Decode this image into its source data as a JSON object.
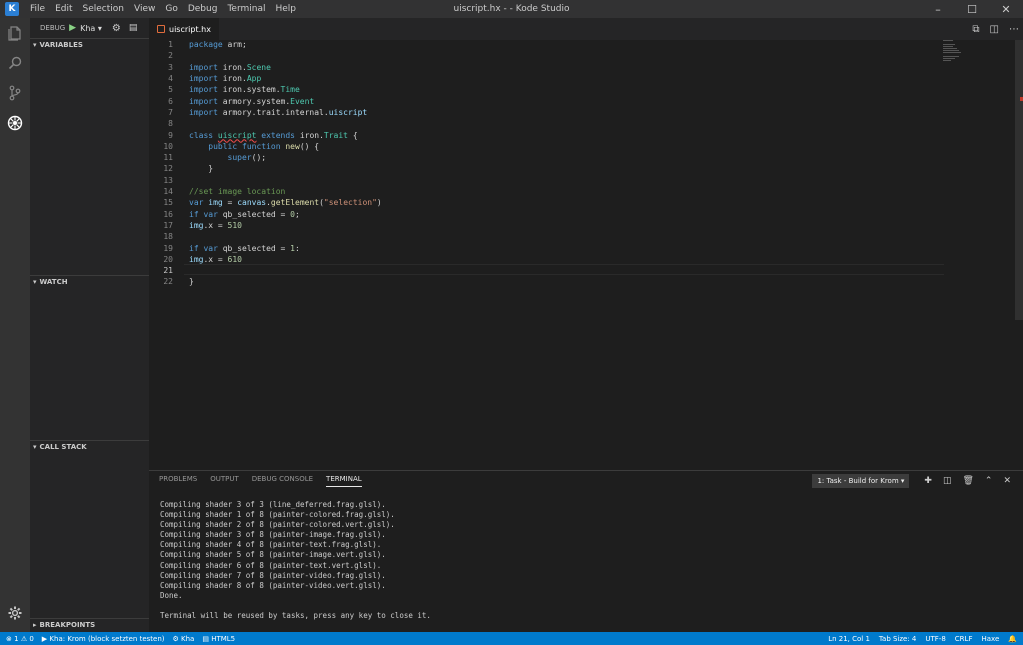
{
  "window": {
    "title": "uiscript.hx - - Kode Studio",
    "menu": [
      "File",
      "Edit",
      "Selection",
      "View",
      "Go",
      "Debug",
      "Terminal",
      "Help"
    ]
  },
  "debug_toolbar": {
    "label": "DEBUG",
    "config": "Kha"
  },
  "sidebar": {
    "variables": "VARIABLES",
    "watch": "WATCH",
    "call_stack": "CALL STACK",
    "breakpoints": "BREAKPOINTS"
  },
  "editor": {
    "tab_label": "uiscript.hx",
    "lines": [
      {
        "n": "1"
      },
      {
        "n": "2"
      },
      {
        "n": "3"
      },
      {
        "n": "4"
      },
      {
        "n": "5"
      },
      {
        "n": "6"
      },
      {
        "n": "7"
      },
      {
        "n": "8"
      },
      {
        "n": "9"
      },
      {
        "n": "10"
      },
      {
        "n": "11"
      },
      {
        "n": "12"
      },
      {
        "n": "13"
      },
      {
        "n": "14"
      },
      {
        "n": "15"
      },
      {
        "n": "16"
      },
      {
        "n": "17"
      },
      {
        "n": "18"
      },
      {
        "n": "19"
      },
      {
        "n": "20"
      },
      {
        "n": "21"
      },
      {
        "n": "22"
      }
    ],
    "code": {
      "l1a": "package",
      "l1b": " arm;",
      "l3a": "import",
      "l3b": " iron.",
      "l3c": "Scene",
      "l4a": "import",
      "l4b": " iron.",
      "l4c": "App",
      "l5a": "import",
      "l5b": " iron.system.",
      "l5c": "Time",
      "l6a": "import",
      "l6b": " armory.system.",
      "l6c": "Event",
      "l7a": "import",
      "l7b": " armory.trait.internal.",
      "l7c": "uiscript",
      "l9a": "class",
      "l9b": " ",
      "l9c": "uiscript",
      "l9d": " ",
      "l9e": "extends",
      "l9f": " iron.",
      "l9g": "Trait",
      "l9h": " {",
      "l10a": "    ",
      "l10b": "public",
      "l10c": " ",
      "l10d": "function",
      "l10e": " ",
      "l10f": "new",
      "l10g": "() {",
      "l11a": "        ",
      "l11b": "super",
      "l11c": "();",
      "l12": "    }",
      "l14": "//set image location",
      "l15a": "var",
      "l15b": " ",
      "l15c": "img",
      "l15d": " = ",
      "l15e": "canvas",
      "l15f": ".",
      "l15g": "getElement",
      "l15h": "(",
      "l15i": "\"selection\"",
      "l15j": ")",
      "l16a": "if",
      "l16b": " ",
      "l16c": "var",
      "l16d": " qb_selected = ",
      "l16e": "0",
      "l16f": ";",
      "l17a": "img",
      "l17b": ".x = ",
      "l17c": "510",
      "l19a": "if",
      "l19b": " ",
      "l19c": "var",
      "l19d": " qb_selected = ",
      "l19e": "1",
      "l19f": ":",
      "l20a": "img",
      "l20b": ".x = ",
      "l20c": "610",
      "l22": "}"
    }
  },
  "panel": {
    "tabs": [
      "PROBLEMS",
      "OUTPUT",
      "DEBUG CONSOLE",
      "TERMINAL"
    ],
    "task": "1: Task - Build for Krom",
    "terminal_lines": "Compiling shader 3 of 3 (line_deferred.frag.glsl).\nCompiling shader 1 of 8 (painter-colored.frag.glsl).\nCompiling shader 2 of 8 (painter-colored.vert.glsl).\nCompiling shader 3 of 8 (painter-image.frag.glsl).\nCompiling shader 4 of 8 (painter-text.frag.glsl).\nCompiling shader 5 of 8 (painter-image.vert.glsl).\nCompiling shader 6 of 8 (painter-text.vert.glsl).\nCompiling shader 7 of 8 (painter-video.frag.glsl).\nCompiling shader 8 of 8 (painter-video.vert.glsl).\nDone.\n\nTerminal will be reused by tasks, press any key to close it."
  },
  "status": {
    "errors": "1",
    "warnings": "0",
    "debug_target": "Kha: Krom (block setzten testen)",
    "kha": "Kha",
    "html5": "HTML5",
    "position": "Ln 21, Col 1",
    "tab_size": "Tab Size: 4",
    "encoding": "UTF-8",
    "eol": "CRLF",
    "language": "Haxe"
  },
  "colors": {
    "accent": "#007acc",
    "keyword": "#569cd6",
    "type": "#4ec9b0",
    "string": "#ce9178",
    "comment": "#6a9955"
  }
}
